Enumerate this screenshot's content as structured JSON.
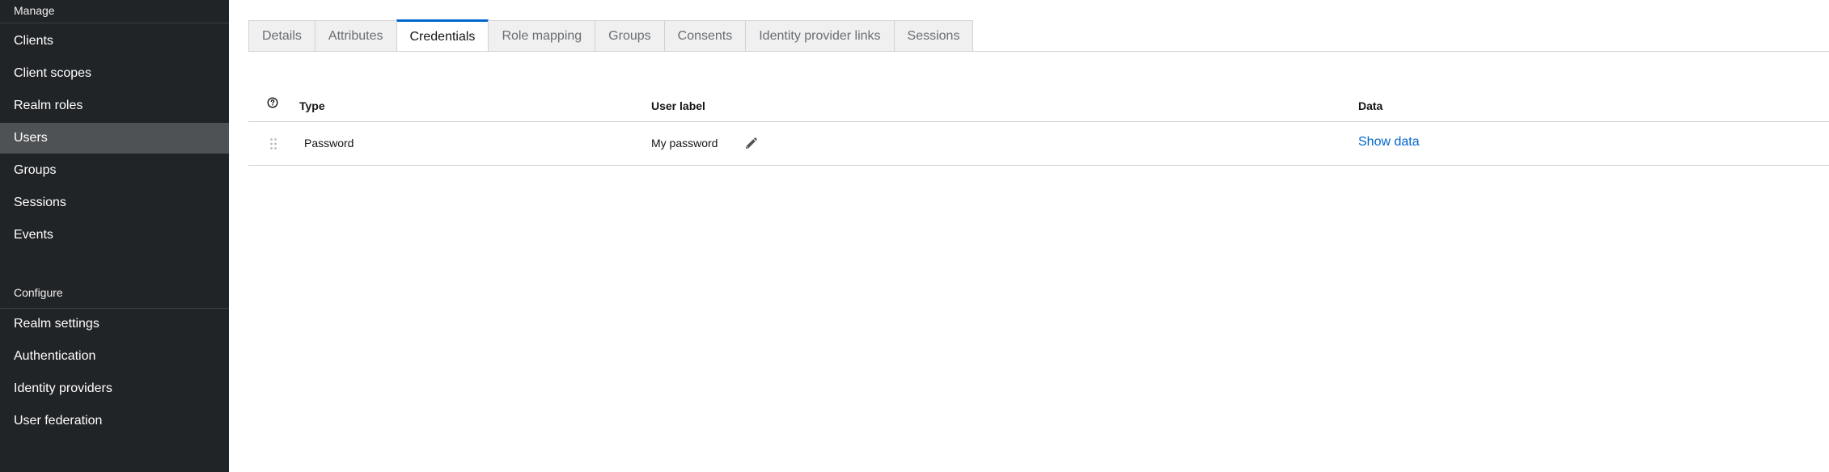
{
  "sidebar": {
    "manage_title": "Manage",
    "manage_items": [
      "Clients",
      "Client scopes",
      "Realm roles",
      "Users",
      "Groups",
      "Sessions",
      "Events"
    ],
    "active_item": "Users",
    "configure_title": "Configure",
    "configure_items": [
      "Realm settings",
      "Authentication",
      "Identity providers",
      "User federation"
    ]
  },
  "tabs": [
    {
      "label": "Details"
    },
    {
      "label": "Attributes"
    },
    {
      "label": "Credentials"
    },
    {
      "label": "Role mapping"
    },
    {
      "label": "Groups"
    },
    {
      "label": "Consents"
    },
    {
      "label": "Identity provider links"
    },
    {
      "label": "Sessions"
    }
  ],
  "active_tab": "Credentials",
  "table": {
    "headers": {
      "type": "Type",
      "user_label": "User label",
      "data": "Data"
    },
    "help_icon": "help-circle-icon",
    "rows": [
      {
        "type": "Password",
        "user_label": "My password",
        "data_action": "Show data"
      }
    ]
  },
  "colors": {
    "sidebar_bg": "#212427",
    "sidebar_active": "#4f5255",
    "accent": "#0066cc"
  }
}
